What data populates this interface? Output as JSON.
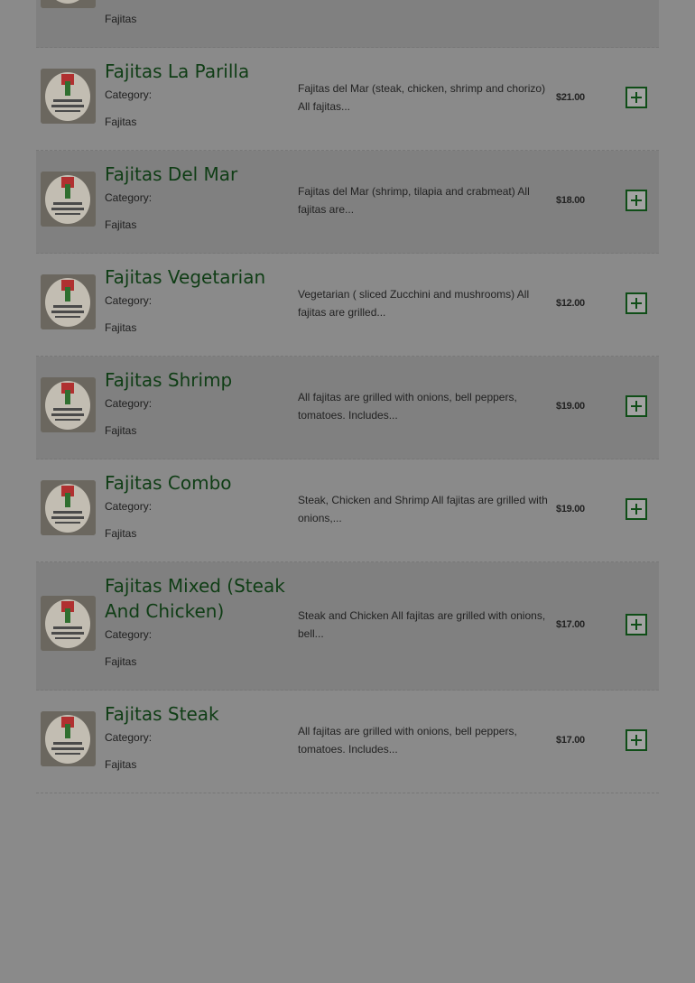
{
  "items": [
    {
      "name": "",
      "category_label": "",
      "category": "Fajitas",
      "description": "",
      "price": ""
    },
    {
      "name": "Fajitas La Parilla",
      "category_label": "Category:",
      "category": "Fajitas",
      "description": "Fajitas del Mar (steak, chicken, shrimp and chorizo) All fajitas...",
      "price": "$21.00"
    },
    {
      "name": "Fajitas Del Mar",
      "category_label": "Category:",
      "category": "Fajitas",
      "description": "Fajitas del Mar (shrimp, tilapia and crabmeat) All fajitas are...",
      "price": "$18.00"
    },
    {
      "name": "Fajitas Vegetarian",
      "category_label": "Category:",
      "category": "Fajitas",
      "description": "Vegetarian ( sliced Zucchini and mushrooms) All fajitas are grilled...",
      "price": "$12.00"
    },
    {
      "name": "Fajitas Shrimp",
      "category_label": "Category:",
      "category": "Fajitas",
      "description": "All fajitas are grilled with onions, bell peppers, tomatoes. Includes...",
      "price": "$19.00"
    },
    {
      "name": "Fajitas Combo",
      "category_label": "Category:",
      "category": "Fajitas",
      "description": "Steak, Chicken and Shrimp All fajitas are grilled with onions,...",
      "price": "$19.00"
    },
    {
      "name": "Fajitas Mixed (Steak And Chicken)",
      "category_label": "Category:",
      "category": "Fajitas",
      "description": "Steak and Chicken All fajitas are grilled with onions, bell...",
      "price": "$17.00"
    },
    {
      "name": "Fajitas Steak",
      "category_label": "Category:",
      "category": "Fajitas",
      "description": "All fajitas are grilled with onions, bell peppers, tomatoes. Includes...",
      "price": "$17.00"
    }
  ],
  "icons": {
    "thumbnail": "restaurant-logo-icon",
    "add": "plus-square-icon"
  },
  "colors": {
    "title": "#0f3d15",
    "add_button": "#0f4d17",
    "overlay_bg": "#8a8a8a"
  }
}
